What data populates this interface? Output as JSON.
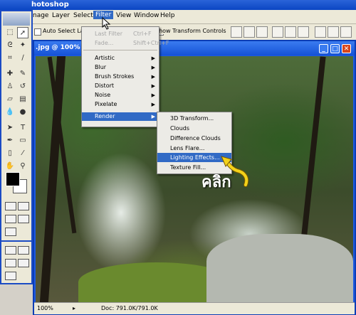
{
  "app": {
    "title": "hotoshop"
  },
  "menubar": {
    "items": [
      {
        "label": "nage"
      },
      {
        "label": "Layer"
      },
      {
        "label": "Select"
      },
      {
        "label": "Filter"
      },
      {
        "label": "View"
      },
      {
        "label": "Window"
      },
      {
        "label": "Help"
      }
    ]
  },
  "options": {
    "auto_select_label": "Auto Select Layer",
    "show_transform_label": "Show Transform Controls"
  },
  "document": {
    "title": ".jpg @ 100% (I",
    "zoom": "100%",
    "doc_info": "Doc: 791.0K/791.0K"
  },
  "filter_menu": {
    "last_filter": {
      "label": "Last Filter",
      "shortcut": "Ctrl+F"
    },
    "fade": {
      "label": "Fade...",
      "shortcut": "Shift+Ctrl+F"
    },
    "items": [
      {
        "label": "Artistic"
      },
      {
        "label": "Blur"
      },
      {
        "label": "Brush Strokes"
      },
      {
        "label": "Distort"
      },
      {
        "label": "Noise"
      },
      {
        "label": "Pixelate"
      },
      {
        "label": "Render"
      }
    ],
    "arrow_glyph": "▶"
  },
  "render_submenu": {
    "items": [
      {
        "label": "3D Transform..."
      },
      {
        "label": "Clouds"
      },
      {
        "label": "Difference Clouds"
      },
      {
        "label": "Lens Flare..."
      },
      {
        "label": "Lighting Effects..."
      },
      {
        "label": "Texture Fill..."
      }
    ]
  },
  "annotation": {
    "caption": "คลิก",
    "arrow_color": "#f3d21a"
  },
  "colors": {
    "title_blue": "#0b46c3",
    "highlight": "#316ac5",
    "menu_bg": "#ecebe6",
    "close_red": "#d8461c"
  }
}
